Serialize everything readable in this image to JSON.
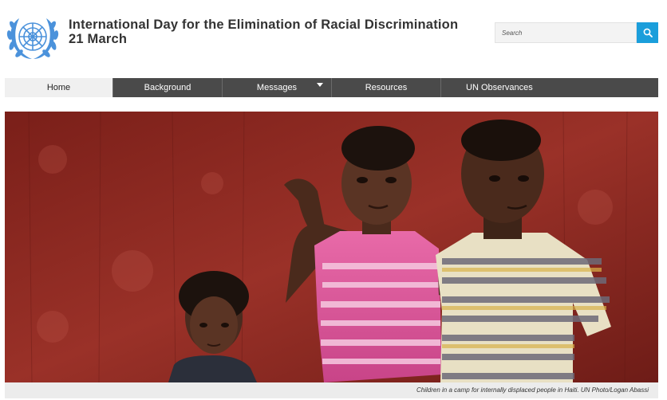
{
  "header": {
    "title_line1": "International Day for the Elimination of Racial Discrimination",
    "title_line2": "21 March",
    "logo_icon": "un-emblem-icon"
  },
  "search": {
    "placeholder": "Search",
    "button_icon": "search-icon"
  },
  "nav": {
    "items": [
      {
        "label": "Home",
        "active": true
      },
      {
        "label": "Background",
        "active": false
      },
      {
        "label": "Messages",
        "active": false,
        "has_dropdown": true
      },
      {
        "label": "Resources",
        "active": false
      },
      {
        "label": "UN Observances",
        "active": false
      }
    ]
  },
  "hero": {
    "caption": "Children in a camp for internally displaced people in Haiti. UN Photo/Logan Abassi"
  },
  "colors": {
    "accent": "#1a9edb",
    "nav_bg": "#4a4a4a",
    "nav_active_bg": "#f0f0f0",
    "un_blue": "#4b92db",
    "hero_wall": "#8b2a22"
  }
}
